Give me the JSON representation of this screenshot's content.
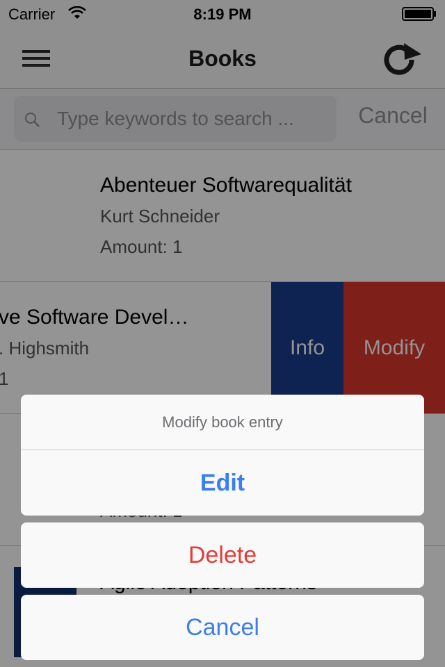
{
  "status_bar": {
    "carrier": "Carrier",
    "time": "8:19 PM"
  },
  "nav": {
    "title": "Books",
    "left_icon": "menu-icon",
    "right_icon": "refresh-icon"
  },
  "search": {
    "placeholder": "Type keywords to search ...",
    "cancel_label": "Cancel"
  },
  "books": [
    {
      "title": "Abenteuer Softwarequalität",
      "author": "Kurt Schneider",
      "amount": "Amount: 1"
    },
    {
      "title": "ve Software Devel…",
      "author": ". Highsmith",
      "amount": "1"
    },
    {
      "title": "",
      "author": "",
      "amount": "Amount: 1"
    },
    {
      "title": "Agile Adoption Patterns",
      "author": "",
      "amount": ""
    }
  ],
  "swipe_actions": {
    "info": "Info",
    "modify": "Modify"
  },
  "action_sheet": {
    "title": "Modify book entry",
    "edit": "Edit",
    "delete": "Delete",
    "cancel": "Cancel"
  },
  "colors": {
    "info": "#1b3d8f",
    "modify": "#d9362c",
    "action_blue": "#3a7ef0",
    "destructive": "#e53c35"
  }
}
